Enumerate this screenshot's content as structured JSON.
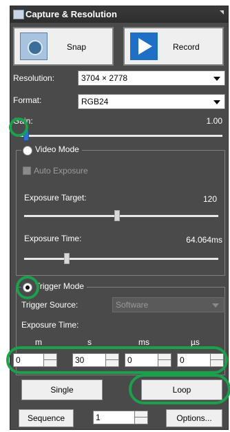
{
  "title": "Capture & Resolution",
  "buttons": {
    "snap": "Snap",
    "record": "Record",
    "single": "Single",
    "loop": "Loop",
    "sequence": "Sequence",
    "options": "Options..."
  },
  "resolution": {
    "label": "Resolution:",
    "value": "3704 × 2778"
  },
  "format": {
    "label": "Format:",
    "value": "RGB24"
  },
  "gain": {
    "label": "Gain:",
    "value": "1.00",
    "fraction": 0.03
  },
  "video_mode": {
    "title": "Video Mode",
    "auto_exposure": "Auto Exposure",
    "exposure_target": {
      "label": "Exposure Target:",
      "value": "120",
      "fraction": 0.48
    },
    "exposure_time": {
      "label": "Exposure Time:",
      "value": "64.064ms",
      "fraction": 0.22
    }
  },
  "trigger_mode": {
    "title": "Trigger Mode",
    "source_label": "Trigger Source:",
    "source_value": "Software",
    "exposure_time_label": "Exposure Time:",
    "units": [
      "m",
      "s",
      "ms",
      "µs"
    ],
    "values": [
      "0",
      "30",
      "0",
      "0"
    ]
  },
  "sequence_count": "1",
  "colors": {
    "panel": "#4a4a4a",
    "highlight": "#1aa14b",
    "slider_blue": "#2a73cc"
  },
  "icons": [
    "camera-icon",
    "play-icon",
    "collapse-arrow-icon"
  ]
}
